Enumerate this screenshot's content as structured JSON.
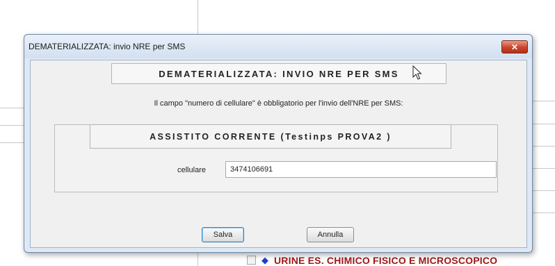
{
  "background": {
    "exam_row_text": "URINE ES. CHIMICO FISICO E MICROSCOPICO",
    "exam_colors": {
      "text": "#a01818",
      "diamond": "#1f3fd0"
    }
  },
  "dialog": {
    "title": "DEMATERIALIZZATA: invio NRE per SMS",
    "close_icon": "close-icon",
    "header": "DEMATERIALIZZATA: INVIO NRE PER SMS",
    "info": "Il campo \"numero di cellulare\" è obbligatorio per l'invio dell'NRE per SMS:",
    "patient_header": "ASSISTITO CORRENTE (Testinps PROVA2 )",
    "phone": {
      "label": "cellulare",
      "value": "3474106691"
    },
    "buttons": {
      "save": "Salva",
      "cancel": "Annulla"
    },
    "colors": {
      "close_button": "#c9452a",
      "default_button_border": "#3c7fb1"
    }
  }
}
